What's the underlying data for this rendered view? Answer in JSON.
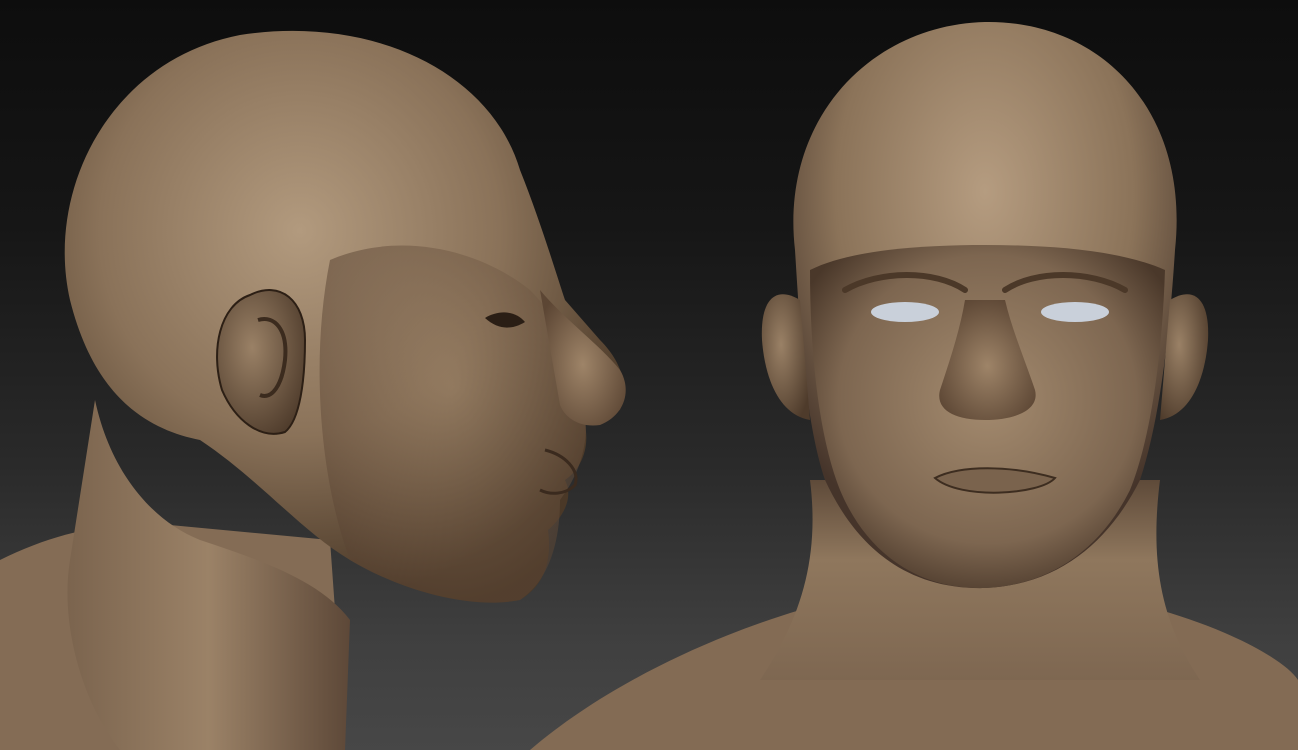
{
  "scene": {
    "background_top": "#0d0d0d",
    "background_bottom": "#474747",
    "skin_light": "#a58c70",
    "skin_mid": "#7d6650",
    "skin_shadow": "#3a2b1f",
    "eye_color": "#c9d0da"
  },
  "views": [
    {
      "id": "side",
      "description": "profile"
    },
    {
      "id": "front",
      "description": "front"
    }
  ]
}
